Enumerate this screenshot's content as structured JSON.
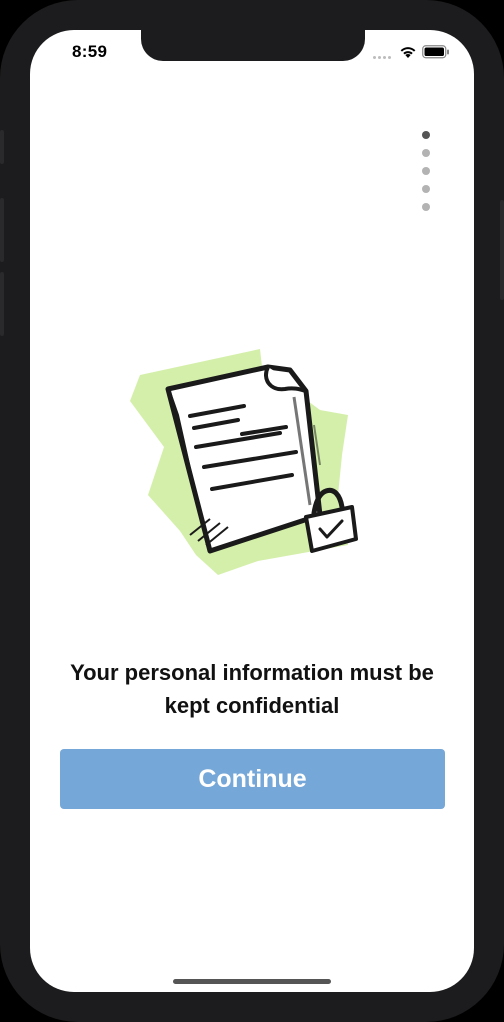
{
  "status_bar": {
    "time": "8:59",
    "wifi_icon": "wifi-icon",
    "battery_icon": "battery-icon"
  },
  "pagination": {
    "total": 5,
    "current": 1
  },
  "illustration": {
    "icon": "locked-document-icon",
    "accent_color": "#d4efaa"
  },
  "onboarding": {
    "headline": "Your personal information must be kept confidential",
    "continue_label": "Continue"
  },
  "colors": {
    "button": "#75a7d8",
    "button_text": "#ffffff"
  }
}
